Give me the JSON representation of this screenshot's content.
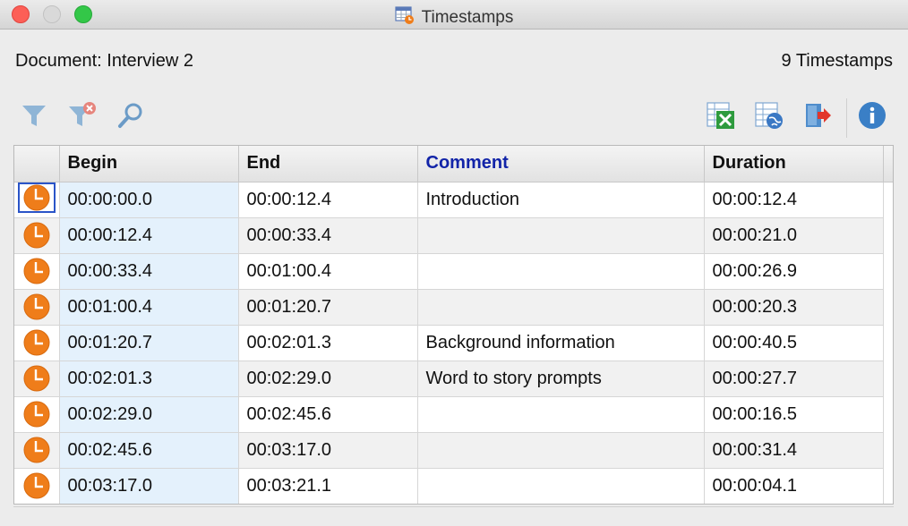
{
  "window": {
    "title": "Timestamps",
    "title_icon": "timestamp-table-icon"
  },
  "header": {
    "document_label": "Document: Interview 2",
    "count_label": "9 Timestamps"
  },
  "toolbar": {
    "left": [
      {
        "name": "filter-icon",
        "tooltip": ""
      },
      {
        "name": "clear-filter-icon",
        "tooltip": ""
      },
      {
        "name": "search-icon",
        "tooltip": ""
      }
    ],
    "right": [
      {
        "name": "export-excel-icon"
      },
      {
        "name": "export-html-icon"
      },
      {
        "name": "export-icon"
      },
      {
        "name": "info-icon"
      }
    ]
  },
  "table": {
    "columns": [
      "",
      "Begin",
      "End",
      "Comment",
      "Duration"
    ],
    "rows": [
      {
        "icon": "clock-icon",
        "begin": "00:00:00.0",
        "end": "00:00:12.4",
        "comment": "Introduction",
        "duration": "00:00:12.4"
      },
      {
        "icon": "clock-icon",
        "begin": "00:00:12.4",
        "end": "00:00:33.4",
        "comment": "",
        "duration": "00:00:21.0"
      },
      {
        "icon": "clock-icon",
        "begin": "00:00:33.4",
        "end": "00:01:00.4",
        "comment": "",
        "duration": "00:00:26.9"
      },
      {
        "icon": "clock-icon",
        "begin": "00:01:00.4",
        "end": "00:01:20.7",
        "comment": "",
        "duration": "00:00:20.3"
      },
      {
        "icon": "clock-icon",
        "begin": "00:01:20.7",
        "end": "00:02:01.3",
        "comment": "Background information",
        "duration": "00:00:40.5"
      },
      {
        "icon": "clock-icon",
        "begin": "00:02:01.3",
        "end": "00:02:29.0",
        "comment": "Word to story prompts",
        "duration": "00:00:27.7"
      },
      {
        "icon": "clock-icon",
        "begin": "00:02:29.0",
        "end": "00:02:45.6",
        "comment": "",
        "duration": "00:00:16.5"
      },
      {
        "icon": "clock-icon",
        "begin": "00:02:45.6",
        "end": "00:03:17.0",
        "comment": "",
        "duration": "00:00:31.4"
      },
      {
        "icon": "clock-icon",
        "begin": "00:03:17.0",
        "end": "00:03:21.1",
        "comment": "",
        "duration": "00:00:04.1"
      }
    ]
  },
  "colors": {
    "clock": "#ef7d1a",
    "comment_header": "#1224a8",
    "begin_column": "#e4f1fc",
    "selection": "#2a54c8"
  }
}
